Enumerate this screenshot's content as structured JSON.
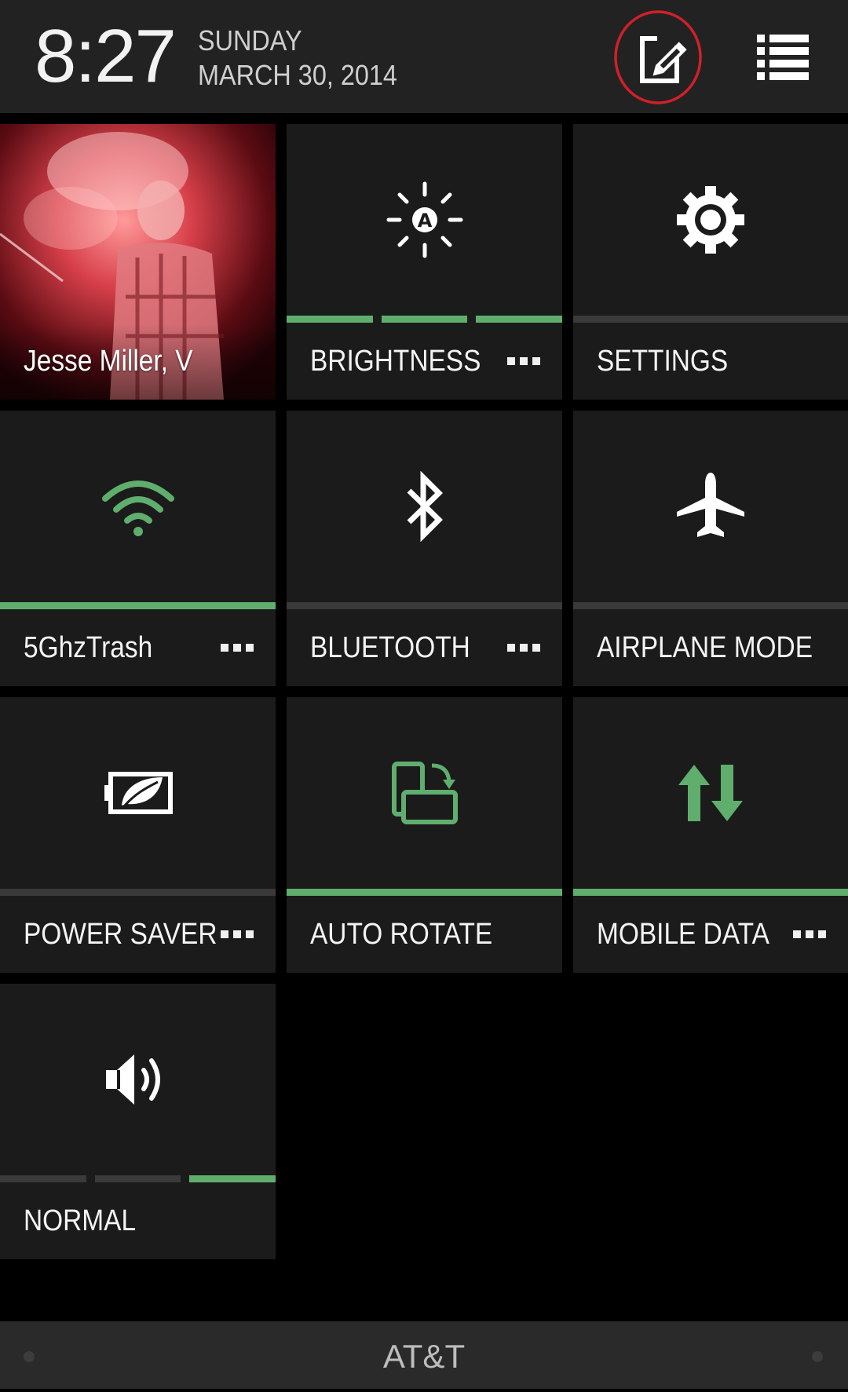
{
  "header": {
    "time": "8:27",
    "day": "SUNDAY",
    "date": "MARCH 30, 2014",
    "edit_icon": "edit-pencil-icon",
    "menu_icon": "list-menu-icon",
    "highlight_color": "#d0202a"
  },
  "tiles": {
    "contact": {
      "label": "Jesse Miller, V"
    },
    "brightness": {
      "label": "BRIGHTNESS",
      "icon": "auto-brightness-icon",
      "level": "3 of 3"
    },
    "settings": {
      "label": "SETTINGS",
      "icon": "gear-icon"
    },
    "wifi": {
      "label": "5GhzTrash",
      "icon": "wifi-icon",
      "active": true
    },
    "bluetooth": {
      "label": "BLUETOOTH",
      "icon": "bluetooth-icon",
      "active": false
    },
    "airplane": {
      "label": "AIRPLANE MODE",
      "icon": "airplane-icon",
      "active": false
    },
    "power_saver": {
      "label": "POWER SAVER",
      "icon": "power-saver-icon",
      "active": false
    },
    "auto_rotate": {
      "label": "AUTO ROTATE",
      "icon": "auto-rotate-icon",
      "active": true
    },
    "mobile_data": {
      "label": "MOBILE DATA",
      "icon": "mobile-data-icon",
      "active": true
    },
    "sound": {
      "label": "NORMAL",
      "icon": "speaker-icon",
      "level": "3 of 3"
    }
  },
  "carrier": {
    "name": "AT&T"
  },
  "colors": {
    "accent": "#5fae6e",
    "tile_bg": "#1b1b1b",
    "header_bg": "#222222",
    "inactive_bar": "#3a3a3a"
  }
}
